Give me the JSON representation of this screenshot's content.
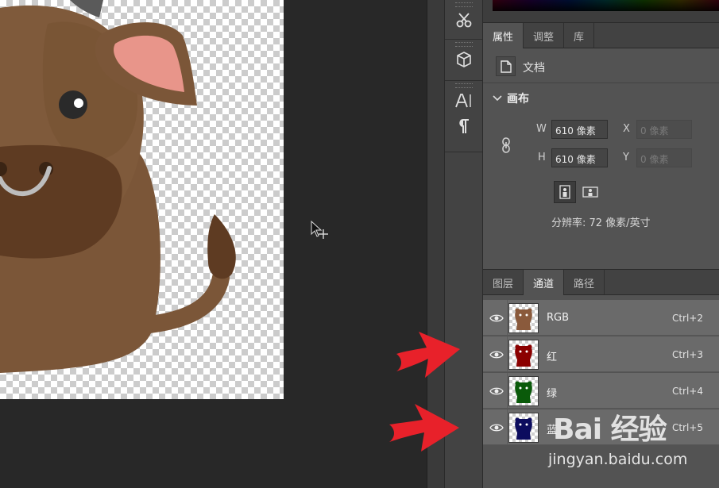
{
  "properties_panel": {
    "tabs": [
      {
        "label": "属性",
        "active": true
      },
      {
        "label": "调整",
        "active": false
      },
      {
        "label": "库",
        "active": false
      }
    ],
    "document_label": "文档",
    "canvas_section_title": "画布",
    "fields": {
      "w_label": "W",
      "w_value": "610 像素",
      "h_label": "H",
      "h_value": "610 像素",
      "x_label": "X",
      "x_placeholder": "0 像素",
      "y_label": "Y",
      "y_placeholder": "0 像素"
    },
    "resolution": "分辨率: 72 像素/英寸"
  },
  "channels_panel": {
    "tabs": [
      {
        "label": "图层",
        "active": false
      },
      {
        "label": "通道",
        "active": true
      },
      {
        "label": "路径",
        "active": false
      }
    ],
    "channels": [
      {
        "name": "RGB",
        "shortcut": "Ctrl+2",
        "thumb_color": "#8a5a3c"
      },
      {
        "name": "红",
        "shortcut": "Ctrl+3",
        "thumb_color": "#8b0000"
      },
      {
        "name": "绿",
        "shortcut": "Ctrl+4",
        "thumb_color": "#0a5a0a"
      },
      {
        "name": "蓝",
        "shortcut": "Ctrl+5",
        "thumb_color": "#0c0c5e"
      }
    ]
  },
  "tool_strip": {
    "icons": [
      "tool-presets-icon",
      "3d-cube-icon",
      "character-icon",
      "paragraph-icon"
    ]
  },
  "colors": {
    "annotation_arrow": "#e8212a",
    "bull_body": "#7b5638",
    "bull_muzzle": "#5e3b22",
    "bull_ear_inner": "#e8958a"
  },
  "watermark": {
    "logo": "Bai 经验",
    "url": "jingyan.baidu.com"
  }
}
